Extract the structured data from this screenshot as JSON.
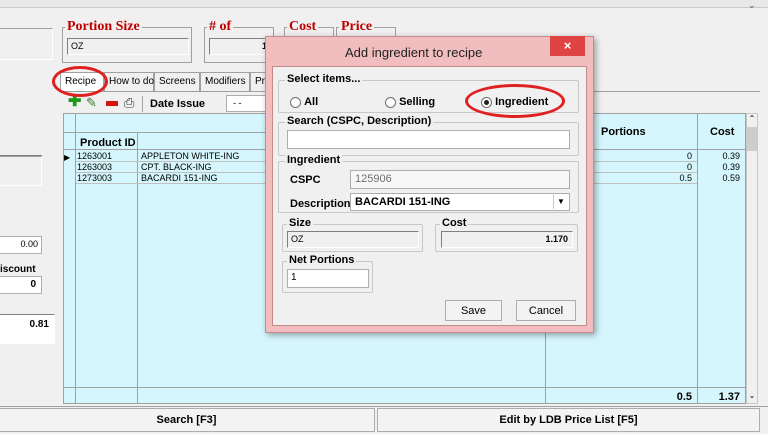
{
  "portion_size": {
    "label": "Portion Size",
    "value": "OZ"
  },
  "num_of": {
    "label": "# of",
    "value": "1"
  },
  "cost": {
    "label": "Cost"
  },
  "price": {
    "label": "Price"
  },
  "tabs": [
    "Recipe",
    "How to do",
    "Screens",
    "Modifiers",
    "Pro"
  ],
  "toolbar": {
    "date_issue_label": "Date Issue",
    "date_value": "- -"
  },
  "grid": {
    "headers": {
      "product_id": "Product ID",
      "portions": "Portions",
      "cost": "Cost"
    },
    "rows": [
      {
        "id": "1263001",
        "name": "APPLETON WHITE-ING",
        "portions": "0",
        "cost": "0.39"
      },
      {
        "id": "1263003",
        "name": "CPT. BLACK-ING",
        "portions": "0",
        "cost": "0.39"
      },
      {
        "id": "1273003",
        "name": "BACARDI 151-ING",
        "portions": "0.5",
        "cost": "0.59"
      }
    ],
    "total_portions": "0.5",
    "total_cost": "1.37"
  },
  "left_panel": {
    "value1": "0.00",
    "discount_label": "iscount",
    "discount_value": "0",
    "value2": "0.81"
  },
  "bottom": {
    "search": "Search [F3]",
    "edit": "Edit by LDB Price List [F5]"
  },
  "dialog": {
    "title": "Add ingredient to recipe",
    "close": "×",
    "select_items": "Select items...",
    "opt_all": "All",
    "opt_selling": "Selling",
    "opt_ingredient": "Ingredient",
    "search_label": "Search (CSPC, Description)",
    "search_value": "",
    "ingredient_label": "Ingredient",
    "cspc_label": "CSPC",
    "cspc_value": "125906",
    "description_label": "Description",
    "description_value": "BACARDI 151-ING",
    "size_label": "Size",
    "size_value": "OZ",
    "cost_label": "Cost",
    "cost_value": "1.170",
    "net_portions_label": "Net Portions",
    "net_portions_value": "1",
    "save": "Save",
    "cancel": "Cancel"
  },
  "colors": {
    "grid_bg": "#d4f6fc",
    "highlight": "#e02020",
    "dialog_title_bg": "#f2bdbf",
    "close_bg": "#e04343"
  }
}
